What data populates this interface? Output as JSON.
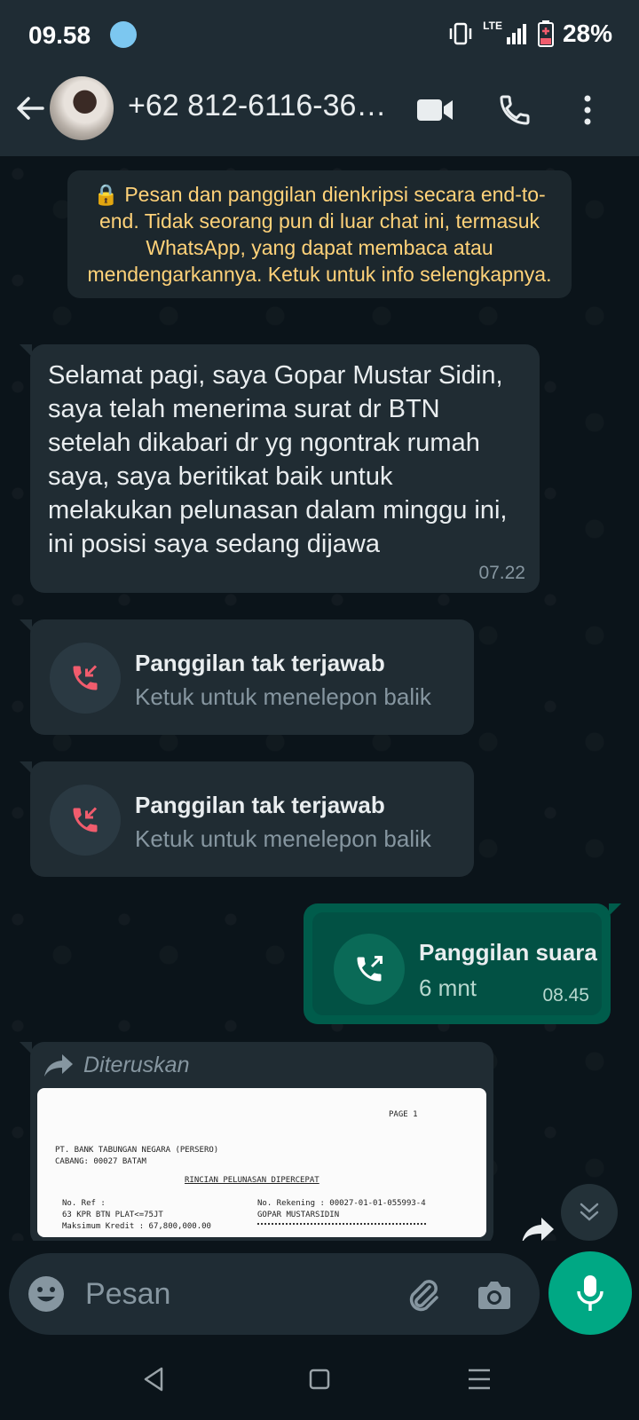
{
  "status_bar": {
    "time": "09.58",
    "network": "LTE",
    "battery": "28%"
  },
  "header": {
    "contact_name": "+62 812-6116-36…",
    "icons": [
      "back-arrow-icon",
      "avatar",
      "video-call-icon",
      "voice-call-icon",
      "more-options-icon"
    ]
  },
  "encryption_notice": "🔒 Pesan dan panggilan dienkripsi secara end-to-end. Tidak seorang pun di luar chat ini, termasuk WhatsApp, yang dapat membaca atau mendengarkannya. Ketuk untuk info selengkapnya.",
  "messages": [
    {
      "type": "text",
      "direction": "incoming",
      "text": "Selamat pagi, saya Gopar Mustar Sidin, saya telah menerima surat dr BTN setelah dikabari dr yg ngontrak rumah saya, saya beritikat baik untuk melakukan pelunasan dalam minggu ini, ini posisi saya sedang dijawa",
      "time": "07.22"
    },
    {
      "type": "missed_call",
      "direction": "incoming",
      "title": "Panggilan tak terjawab",
      "subtitle": "Ketuk untuk menelepon balik"
    },
    {
      "type": "missed_call",
      "direction": "incoming",
      "title": "Panggilan tak terjawab",
      "subtitle": "Ketuk untuk menelepon balik"
    },
    {
      "type": "voice_call",
      "direction": "outgoing",
      "title": "Panggilan suara",
      "subtitle": "6 mnt",
      "time": "08.45"
    },
    {
      "type": "forwarded_image",
      "direction": "incoming",
      "label": "Diteruskan",
      "document": {
        "page": "PAGE   1",
        "bank": "PT. BANK TABUNGAN NEGARA (PERSERO)",
        "branch": "CABANG: 00027 BATAM",
        "heading": "RINCIAN PELUNASAN DIPERCEPAT",
        "ref_label": "No. Ref :",
        "ref_value": "63 KPR BTN PLAT<=75JT",
        "max_credit": "Maksimum Kredit :      67,800,000.00",
        "account": "No. Rekening :      00027-01-01-055993-4",
        "name": "GOPAR MUSTARSIDIN"
      }
    }
  ],
  "composer": {
    "placeholder": "Pesan"
  },
  "colors": {
    "background": "#0b141a",
    "header": "#1f2c34",
    "incoming_bubble": "#202c33",
    "outgoing_bubble": "#005c4b",
    "accent": "#00a884",
    "notice_text": "#ffd279",
    "missed_call": "#f15c6d"
  }
}
